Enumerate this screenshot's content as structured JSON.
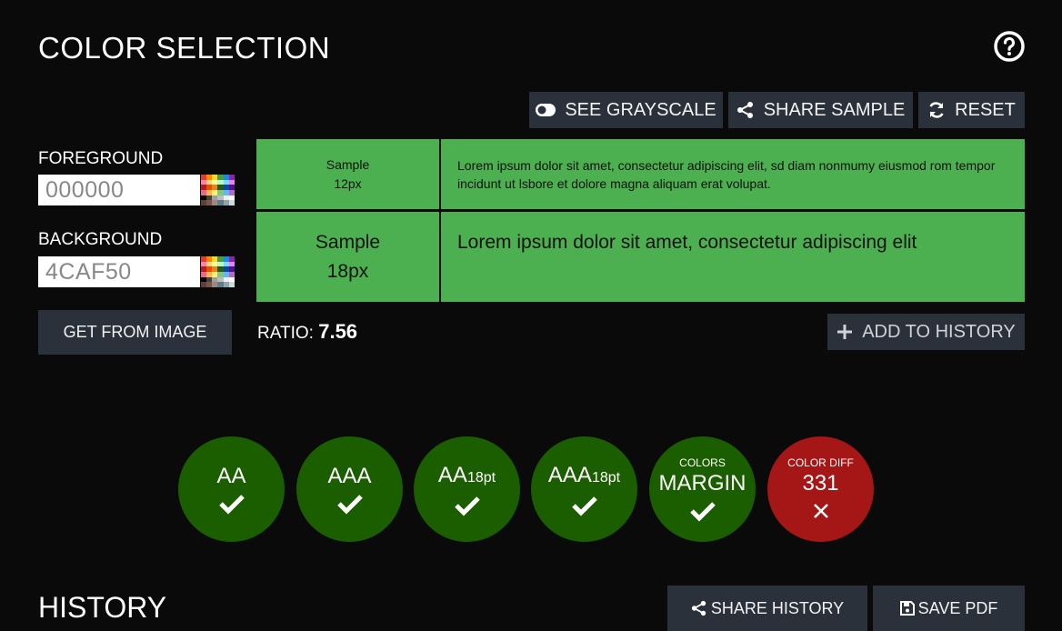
{
  "header": {
    "title": "COLOR SELECTION",
    "help_icon": "question-circle-icon"
  },
  "toolbar": {
    "grayscale_label": "SEE GRAYSCALE",
    "share_sample_label": "SHARE SAMPLE",
    "reset_label": "RESET"
  },
  "foreground": {
    "label": "FOREGROUND",
    "value": "000000"
  },
  "background": {
    "label": "BACKGROUND",
    "value": "4CAF50"
  },
  "get_from_image_label": "GET FROM IMAGE",
  "samples": {
    "small_label_1": "Sample",
    "small_label_2": "12px",
    "large_label_1": "Sample",
    "large_label_2": "18px",
    "small_text": "Lorem ipsum dolor sit amet, consectetur adipiscing elit, sd diam nonmumy eiusmod rom tempor incidunt ut lsbore et dolore magna aliquam erat volupat.",
    "large_text": "Lorem ipsum dolor sit amet, consectetur adipiscing elit",
    "foreground_color": "#000000",
    "background_color": "#4caf50"
  },
  "ratio": {
    "label": "RATIO:",
    "value": "7.56"
  },
  "add_to_history_label": "ADD TO HISTORY",
  "checks": [
    {
      "top": "",
      "main": "AA",
      "sub": "",
      "status": "pass"
    },
    {
      "top": "",
      "main": "AAA",
      "sub": "",
      "status": "pass"
    },
    {
      "top": "",
      "main": "AA",
      "sub": "18pt",
      "status": "pass"
    },
    {
      "top": "",
      "main": "AAA",
      "sub": "18pt",
      "status": "pass"
    },
    {
      "top": "COLORS",
      "main": "MARGIN",
      "sub": "",
      "status": "pass"
    },
    {
      "top": "COLOR DIFF",
      "main": "331",
      "sub": "",
      "status": "fail"
    }
  ],
  "colors": {
    "pass": "#1b5e00",
    "fail": "#a51616",
    "button": "#2b313b",
    "page": "#0a0a0a"
  },
  "history": {
    "title": "HISTORY",
    "share_label": "SHARE HISTORY",
    "save_pdf_label": "SAVE PDF"
  }
}
